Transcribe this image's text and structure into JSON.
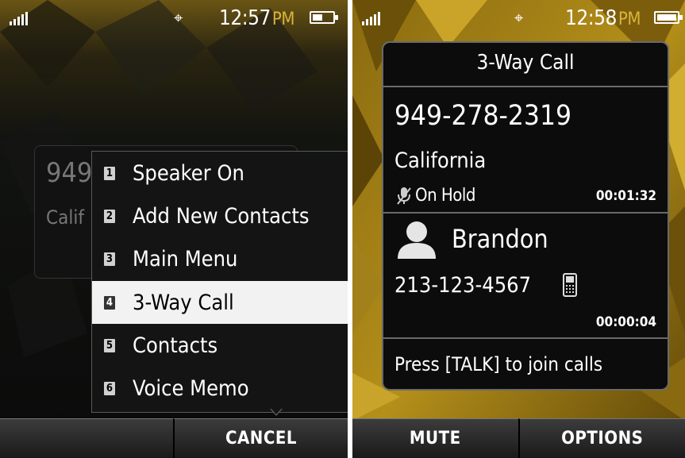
{
  "left_screen": {
    "status": {
      "time": "12:57",
      "ampm": "PM",
      "battery_level": 0.45
    },
    "background_card": {
      "number_fragment": "949",
      "location_fragment": "Calif"
    },
    "menu": {
      "items": [
        {
          "num": "1",
          "label": "Speaker On"
        },
        {
          "num": "2",
          "label": "Add New Contacts"
        },
        {
          "num": "3",
          "label": "Main Menu"
        },
        {
          "num": "4",
          "label": "3-Way Call"
        },
        {
          "num": "5",
          "label": "Contacts"
        },
        {
          "num": "6",
          "label": "Voice Memo"
        }
      ],
      "selected_index": 3
    },
    "softkeys": {
      "left": "",
      "right": "CANCEL"
    }
  },
  "right_screen": {
    "status": {
      "time": "12:58",
      "ampm": "PM",
      "battery_level": 0.9
    },
    "panel": {
      "title": "3-Way Call",
      "held_call": {
        "number": "949-278-2319",
        "location": "California",
        "status": "On Hold",
        "timer": "00:01:32"
      },
      "active_call": {
        "name": "Brandon",
        "number": "213-123-4567",
        "timer": "00:00:04"
      },
      "hint": "Press [TALK] to join calls"
    },
    "softkeys": {
      "left": "MUTE",
      "right": "OPTIONS"
    }
  },
  "icons": [
    "signal-icon",
    "gps-icon",
    "battery-icon",
    "mute-mic-icon",
    "contact-person-icon",
    "mobile-phone-icon"
  ],
  "colors": {
    "accent_gold": "#d8b53a",
    "panel_bg": "#0c0c0c",
    "selected_item": "#f2f2f2"
  }
}
